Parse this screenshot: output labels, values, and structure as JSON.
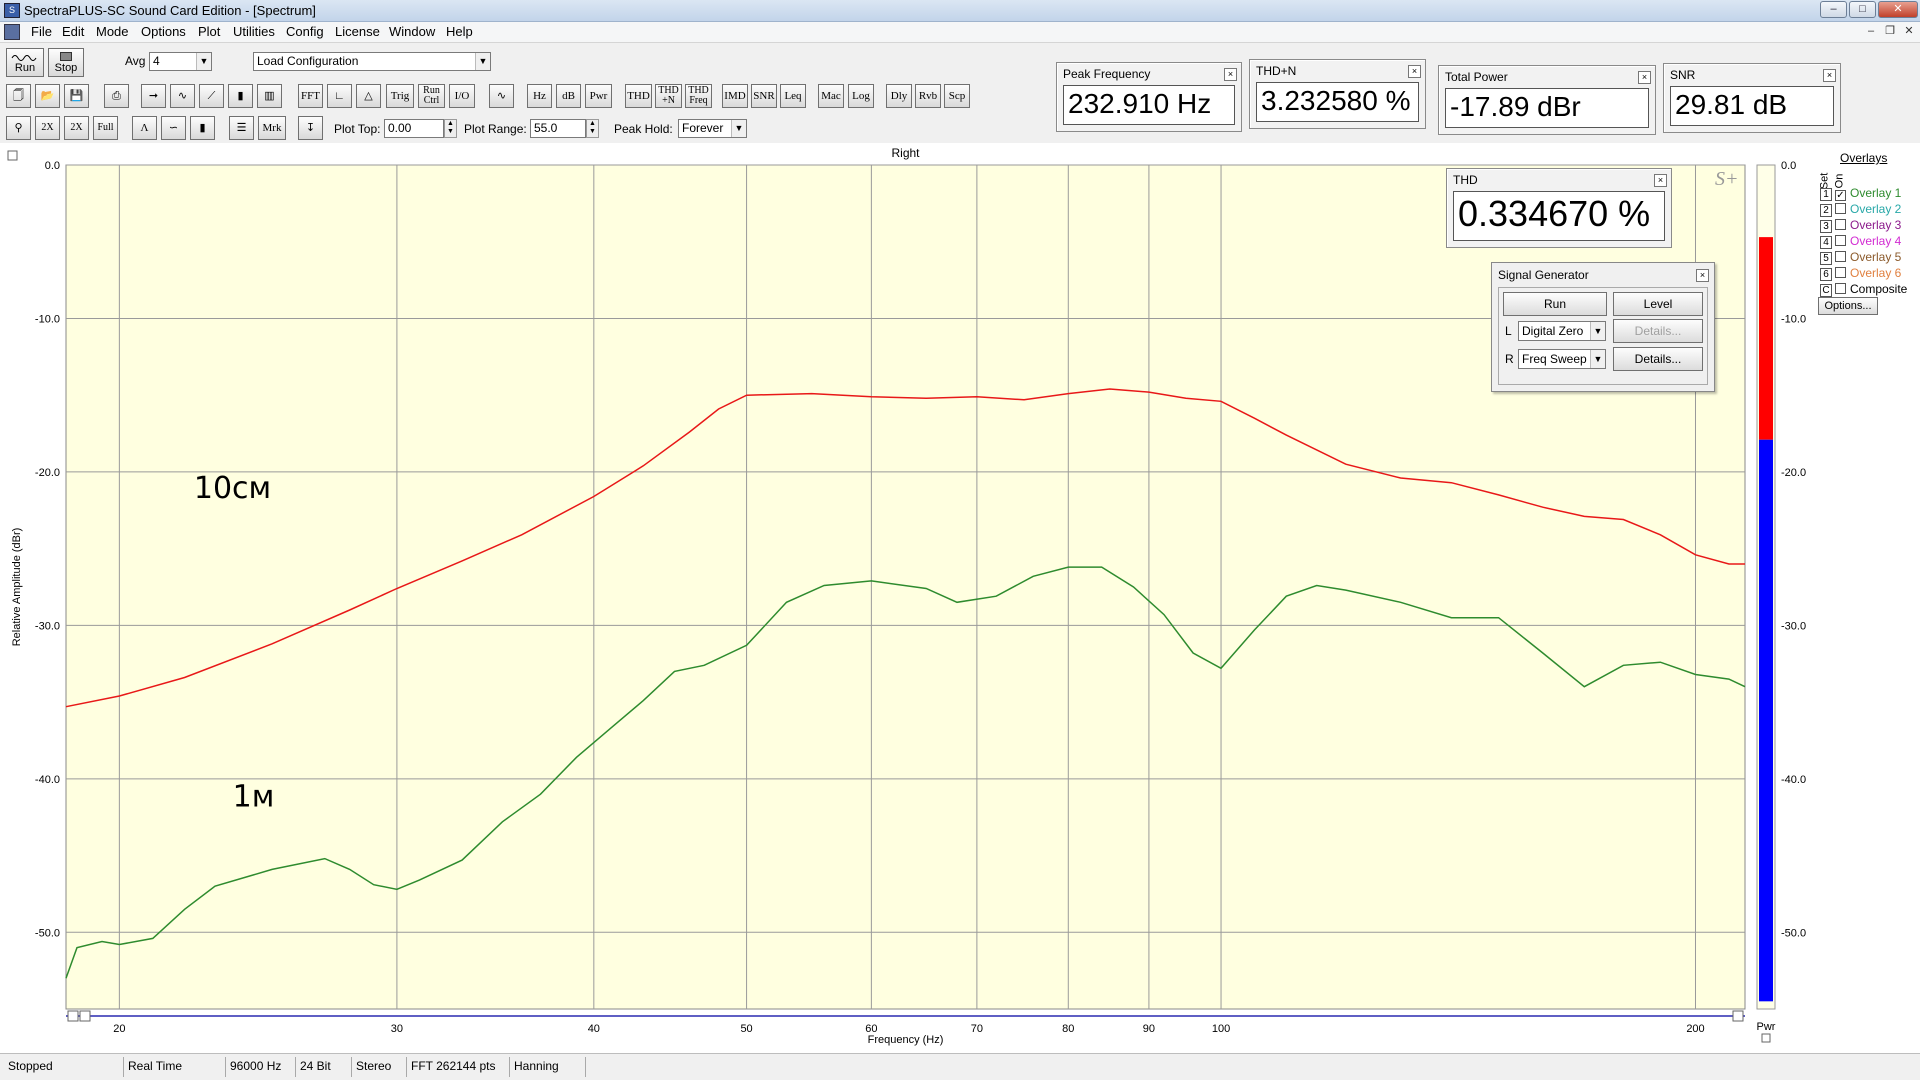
{
  "window": {
    "title": "SpectraPLUS-SC Sound Card Edition - [Spectrum]"
  },
  "menu": [
    "File",
    "Edit",
    "Mode",
    "Options",
    "Plot",
    "Utilities",
    "Config",
    "License",
    "Window",
    "Help"
  ],
  "toolbar": {
    "run_label": "Run",
    "stop_label": "Stop",
    "avg_label": "Avg",
    "avg_value": "4",
    "config_value": "Load Configuration",
    "row2_buttons": [
      "FFT",
      "Trig",
      "Run Ctrl",
      "I/O",
      "Hz",
      "dB",
      "Pwr",
      "THD",
      "THD +N",
      "THD Freq",
      "IMD",
      "SNR",
      "Leq",
      "Mac",
      "Log",
      "Dly",
      "Rvb",
      "Scp"
    ],
    "row3_buttons": [
      "Mrk"
    ],
    "plot_top_label": "Plot Top:",
    "plot_top_value": "0.00",
    "plot_range_label": "Plot Range:",
    "plot_range_value": "55.0",
    "peak_hold_label": "Peak Hold:",
    "peak_hold_value": "Forever"
  },
  "meters": {
    "peak_frequency": {
      "title": "Peak Frequency",
      "value": "232.910 Hz"
    },
    "thd_n": {
      "title": "THD+N",
      "value": "3.232580 %"
    },
    "total_power": {
      "title": "Total Power",
      "value": "-17.89 dBr"
    },
    "snr": {
      "title": "SNR",
      "value": "29.81 dB"
    },
    "thd": {
      "title": "THD",
      "value": "0.334670 %"
    }
  },
  "signal_generator": {
    "title": "Signal Generator",
    "run_label": "Run",
    "level_label": "Level",
    "left_label": "L",
    "left_value": "Digital Zero",
    "left_details": "Details...",
    "right_label": "R",
    "right_value": "Freq Sweep",
    "right_details": "Details..."
  },
  "overlays": {
    "title": "Overlays",
    "set_label": "Set",
    "on_label": "On",
    "items": [
      {
        "num": "1",
        "name": "Overlay 1",
        "checked": true,
        "color": "#2e8b2e"
      },
      {
        "num": "2",
        "name": "Overlay 2",
        "checked": false,
        "color": "#28a8a8"
      },
      {
        "num": "3",
        "name": "Overlay 3",
        "checked": false,
        "color": "#8b1a8b"
      },
      {
        "num": "4",
        "name": "Overlay 4",
        "checked": false,
        "color": "#d22bd2"
      },
      {
        "num": "5",
        "name": "Overlay 5",
        "checked": false,
        "color": "#8b5a2b"
      },
      {
        "num": "6",
        "name": "Overlay 6",
        "checked": false,
        "color": "#e08040"
      },
      {
        "num": "C",
        "name": "Composite",
        "checked": false,
        "color": "#000000"
      }
    ],
    "options_label": "Options..."
  },
  "status": [
    "Stopped",
    "Real Time",
    "96000 Hz",
    "24 Bit",
    "Stereo",
    "FFT 262144 pts",
    "Hanning"
  ],
  "chart_data": {
    "type": "line",
    "title": "Right",
    "xlabel": "Frequency (Hz)",
    "ylabel": "Relative Amplitude (dBr)",
    "x_scale": "log",
    "xlim": [
      18.5,
      215
    ],
    "ylim": [
      -55,
      0
    ],
    "x_ticks": [
      20,
      30,
      40,
      50,
      60,
      70,
      80,
      90,
      100,
      200
    ],
    "y_ticks": [
      "0.0",
      "-10.0",
      "-20.0",
      "-30.0",
      "-40.0",
      "-50.0"
    ],
    "y_tick_values": [
      0,
      -10,
      -20,
      -30,
      -40,
      -50
    ],
    "grid": true,
    "background": "#ffffe0",
    "annotations": [
      {
        "text": "10см",
        "x": 22.3,
        "y": -21.7
      },
      {
        "text": "1м",
        "x": 23.6,
        "y": -41.8
      }
    ],
    "series": [
      {
        "color": "#e81818",
        "x": [
          18.5,
          20,
          22,
          25,
          28,
          30,
          33,
          36,
          40,
          43,
          46,
          48,
          50,
          55,
          60,
          65,
          70,
          75,
          80,
          85,
          90,
          95,
          100,
          105,
          110,
          120,
          130,
          140,
          150,
          160,
          170,
          180,
          190,
          200,
          210,
          215
        ],
        "y": [
          -35.3,
          -34.6,
          -33.4,
          -31.2,
          -29.0,
          -27.6,
          -25.8,
          -24.1,
          -21.6,
          -19.6,
          -17.4,
          -15.9,
          -15.0,
          -14.9,
          -15.1,
          -15.2,
          -15.1,
          -15.3,
          -14.9,
          -14.6,
          -14.8,
          -15.2,
          -15.4,
          -16.5,
          -17.6,
          -19.5,
          -20.4,
          -20.7,
          -21.5,
          -22.3,
          -22.9,
          -23.1,
          -24.1,
          -25.4,
          -26.0,
          -26.0
        ]
      },
      {
        "color": "#2e8b2e",
        "x": [
          18.5,
          18.8,
          19.5,
          20,
          21,
          22,
          23,
          25,
          27,
          28,
          29,
          30,
          31,
          33,
          35,
          37,
          39,
          41,
          43,
          45,
          47,
          50,
          53,
          56,
          60,
          65,
          68,
          72,
          76,
          80,
          84,
          88,
          92,
          96,
          100,
          105,
          110,
          115,
          120,
          130,
          140,
          150,
          160,
          170,
          180,
          190,
          200,
          210,
          215
        ],
        "y": [
          -53.0,
          -51.0,
          -50.6,
          -50.8,
          -50.4,
          -48.5,
          -47.0,
          -45.9,
          -45.2,
          -45.9,
          -46.9,
          -47.2,
          -46.6,
          -45.3,
          -42.8,
          -41.0,
          -38.6,
          -36.7,
          -34.9,
          -33.0,
          -32.6,
          -31.3,
          -28.5,
          -27.4,
          -27.1,
          -27.6,
          -28.5,
          -28.1,
          -26.8,
          -26.2,
          -26.2,
          -27.5,
          -29.3,
          -31.8,
          -32.8,
          -30.3,
          -28.1,
          -27.4,
          -27.7,
          -28.5,
          -29.5,
          -29.5,
          -31.8,
          -34.0,
          -32.6,
          -32.4,
          -33.2,
          -33.5,
          -34.0
        ]
      }
    ]
  }
}
